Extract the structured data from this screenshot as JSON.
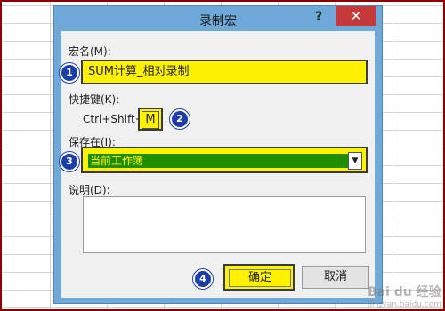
{
  "dialog": {
    "title": "录制宏",
    "help_icon": "?",
    "close_icon": "✕"
  },
  "macro_name": {
    "label": "宏名(M):",
    "value": "SUM计算_相对录制"
  },
  "shortcut": {
    "label": "快捷键(K):",
    "prefix": "Ctrl+Shift+",
    "key": "M"
  },
  "store_in": {
    "label": "保存在(I):",
    "selected": "当前工作簿",
    "dropdown_icon": "▼"
  },
  "description": {
    "label": "说明(D):",
    "value": ""
  },
  "buttons": {
    "ok": "确定",
    "cancel": "取消"
  },
  "badges": [
    "1",
    "2",
    "3",
    "4"
  ],
  "watermark": {
    "text": "Bai du 经验",
    "url": "jingyan.baidu.com"
  },
  "colors": {
    "highlight": "#fff200",
    "selection_green": "#1f8e00",
    "badge_blue": "#1c3ea8",
    "close_red": "#c6393a",
    "frame_blue": "#6fa9d9"
  }
}
